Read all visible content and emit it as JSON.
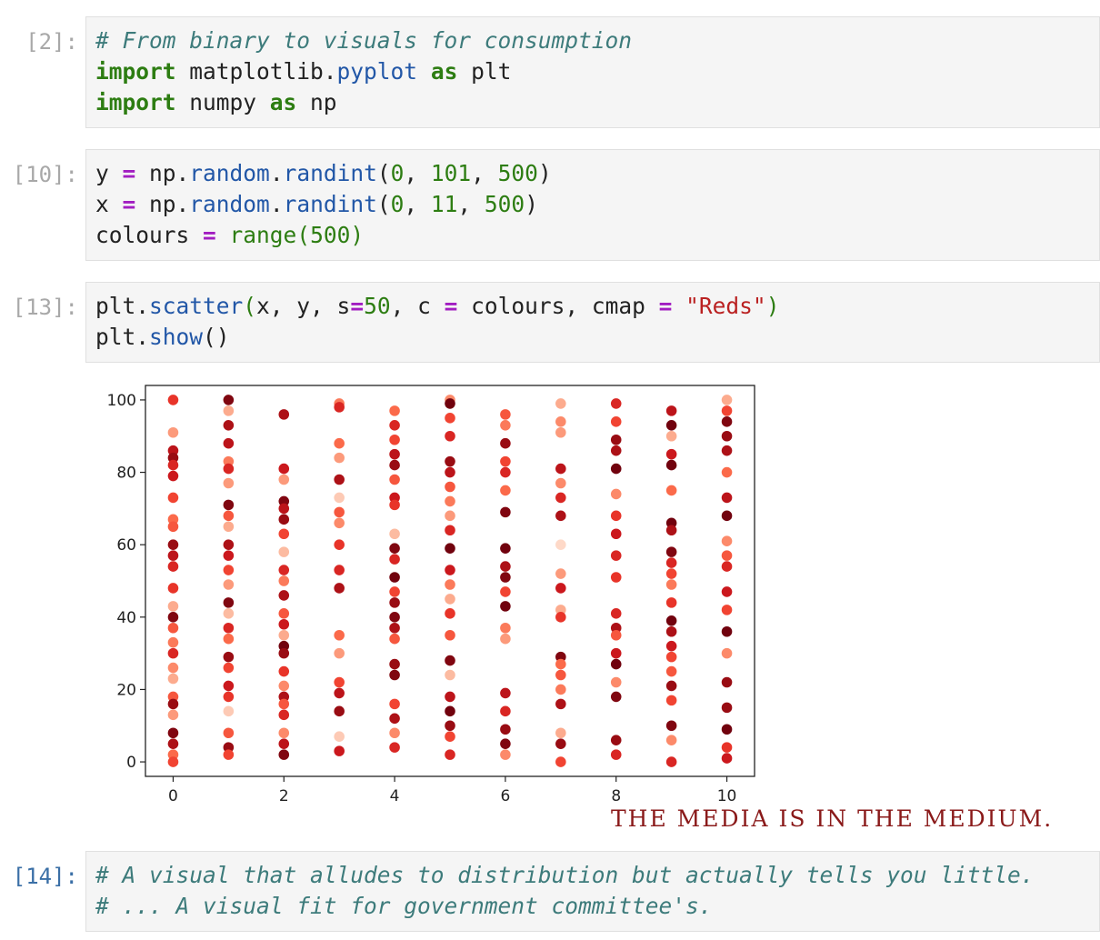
{
  "cells": {
    "c2": {
      "prompt": "[2]:",
      "line1": {
        "comment": "# From binary to visuals for consumption"
      },
      "line2": {
        "kw1": "import",
        "t1": " matplotlib.",
        "attr": "pyplot",
        "t2": " ",
        "kw2": "as",
        "t3": " plt"
      },
      "line3": {
        "kw1": "import",
        "t1": " numpy ",
        "kw2": "as",
        "t2": " np"
      }
    },
    "c10": {
      "prompt": "[10]:",
      "line1": {
        "v": "y ",
        "op": "=",
        "t1": " np.",
        "a1": "random",
        "t2": ".",
        "a2": "randint",
        "p1": "(",
        "n1": "0",
        "t3": ", ",
        "n2": "101",
        "t4": ", ",
        "n3": "500",
        "p2": ")"
      },
      "line2": {
        "v": "x ",
        "op": "=",
        "t1": " np.",
        "a1": "random",
        "t2": ".",
        "a2": "randint",
        "p1": "(",
        "n1": "0",
        "t3": ", ",
        "n2": "11",
        "t4": ", ",
        "n3": "500",
        "p2": ")"
      },
      "line3": {
        "v": "colours ",
        "op": "=",
        "t1": " ",
        "fn": "range",
        "p1": "(",
        "n1": "500",
        "p2": ")"
      }
    },
    "c13": {
      "prompt": "[13]:",
      "line1": {
        "t1": "plt.",
        "a1": "scatter",
        "p1": "(",
        "t2": "x, y, s",
        "op1": "=",
        "n1": "50",
        "t3": ", c ",
        "op2": "=",
        "t4": " colours, cmap ",
        "op3": "=",
        "t5": " ",
        "s1": "\"Reds\"",
        "p2": ")"
      },
      "line2": {
        "t1": "plt.",
        "a1": "show",
        "t2": "()"
      }
    },
    "c14": {
      "prompt": "[14]:",
      "line1": {
        "comment": "# A visual that alludes to distribution but actually tells you little."
      },
      "line2": {
        "comment": "# ... A visual fit for government committee's."
      }
    }
  },
  "caption": "THE MEDIA IS IN THE MEDIUM.",
  "chart_data": {
    "type": "scatter",
    "colormap": "Reds",
    "marker_size": 50,
    "xlim": [
      -0.5,
      10.5
    ],
    "ylim": [
      -4,
      104
    ],
    "xticks": [
      "0",
      "2",
      "4",
      "6",
      "8",
      "10"
    ],
    "yticks": [
      "0",
      "20",
      "40",
      "60",
      "80",
      "100"
    ],
    "points": [
      {
        "x": 0,
        "y": 100,
        "c": 0.65
      },
      {
        "x": 0,
        "y": 91,
        "c": 0.35
      },
      {
        "x": 0,
        "y": 86,
        "c": 0.8
      },
      {
        "x": 0,
        "y": 84,
        "c": 0.9
      },
      {
        "x": 0,
        "y": 82,
        "c": 0.7
      },
      {
        "x": 0,
        "y": 79,
        "c": 0.75
      },
      {
        "x": 0,
        "y": 73,
        "c": 0.6
      },
      {
        "x": 0,
        "y": 67,
        "c": 0.5
      },
      {
        "x": 0,
        "y": 65,
        "c": 0.55
      },
      {
        "x": 0,
        "y": 60,
        "c": 0.9
      },
      {
        "x": 0,
        "y": 57,
        "c": 0.8
      },
      {
        "x": 0,
        "y": 54,
        "c": 0.7
      },
      {
        "x": 0,
        "y": 48,
        "c": 0.65
      },
      {
        "x": 0,
        "y": 43,
        "c": 0.3
      },
      {
        "x": 0,
        "y": 40,
        "c": 0.95
      },
      {
        "x": 0,
        "y": 37,
        "c": 0.55
      },
      {
        "x": 0,
        "y": 33,
        "c": 0.45
      },
      {
        "x": 0,
        "y": 30,
        "c": 0.7
      },
      {
        "x": 0,
        "y": 26,
        "c": 0.4
      },
      {
        "x": 0,
        "y": 23,
        "c": 0.3
      },
      {
        "x": 0,
        "y": 18,
        "c": 0.55
      },
      {
        "x": 0,
        "y": 16,
        "c": 0.9
      },
      {
        "x": 0,
        "y": 13,
        "c": 0.35
      },
      {
        "x": 0,
        "y": 8,
        "c": 0.95
      },
      {
        "x": 0,
        "y": 5,
        "c": 0.85
      },
      {
        "x": 0,
        "y": 2,
        "c": 0.5
      },
      {
        "x": 0,
        "y": 0,
        "c": 0.6
      },
      {
        "x": 1,
        "y": 100,
        "c": 0.95
      },
      {
        "x": 1,
        "y": 97,
        "c": 0.3
      },
      {
        "x": 1,
        "y": 93,
        "c": 0.85
      },
      {
        "x": 1,
        "y": 88,
        "c": 0.8
      },
      {
        "x": 1,
        "y": 83,
        "c": 0.45
      },
      {
        "x": 1,
        "y": 81,
        "c": 0.7
      },
      {
        "x": 1,
        "y": 77,
        "c": 0.35
      },
      {
        "x": 1,
        "y": 71,
        "c": 0.95
      },
      {
        "x": 1,
        "y": 68,
        "c": 0.55
      },
      {
        "x": 1,
        "y": 65,
        "c": 0.3
      },
      {
        "x": 1,
        "y": 60,
        "c": 0.85
      },
      {
        "x": 1,
        "y": 57,
        "c": 0.75
      },
      {
        "x": 1,
        "y": 53,
        "c": 0.6
      },
      {
        "x": 1,
        "y": 49,
        "c": 0.35
      },
      {
        "x": 1,
        "y": 44,
        "c": 0.95
      },
      {
        "x": 1,
        "y": 41,
        "c": 0.25
      },
      {
        "x": 1,
        "y": 37,
        "c": 0.7
      },
      {
        "x": 1,
        "y": 34,
        "c": 0.5
      },
      {
        "x": 1,
        "y": 29,
        "c": 0.9
      },
      {
        "x": 1,
        "y": 26,
        "c": 0.6
      },
      {
        "x": 1,
        "y": 21,
        "c": 0.75
      },
      {
        "x": 1,
        "y": 18,
        "c": 0.65
      },
      {
        "x": 1,
        "y": 14,
        "c": 0.2
      },
      {
        "x": 1,
        "y": 8,
        "c": 0.55
      },
      {
        "x": 1,
        "y": 4,
        "c": 0.9
      },
      {
        "x": 1,
        "y": 2,
        "c": 0.6
      },
      {
        "x": 2,
        "y": 96,
        "c": 0.85
      },
      {
        "x": 2,
        "y": 81,
        "c": 0.75
      },
      {
        "x": 2,
        "y": 78,
        "c": 0.35
      },
      {
        "x": 2,
        "y": 72,
        "c": 0.95
      },
      {
        "x": 2,
        "y": 70,
        "c": 0.8
      },
      {
        "x": 2,
        "y": 67,
        "c": 0.9
      },
      {
        "x": 2,
        "y": 63,
        "c": 0.6
      },
      {
        "x": 2,
        "y": 58,
        "c": 0.25
      },
      {
        "x": 2,
        "y": 53,
        "c": 0.7
      },
      {
        "x": 2,
        "y": 50,
        "c": 0.45
      },
      {
        "x": 2,
        "y": 46,
        "c": 0.85
      },
      {
        "x": 2,
        "y": 41,
        "c": 0.55
      },
      {
        "x": 2,
        "y": 38,
        "c": 0.75
      },
      {
        "x": 2,
        "y": 35,
        "c": 0.3
      },
      {
        "x": 2,
        "y": 32,
        "c": 0.98
      },
      {
        "x": 2,
        "y": 30,
        "c": 0.9
      },
      {
        "x": 2,
        "y": 25,
        "c": 0.65
      },
      {
        "x": 2,
        "y": 21,
        "c": 0.4
      },
      {
        "x": 2,
        "y": 18,
        "c": 0.85
      },
      {
        "x": 2,
        "y": 16,
        "c": 0.55
      },
      {
        "x": 2,
        "y": 13,
        "c": 0.7
      },
      {
        "x": 2,
        "y": 8,
        "c": 0.4
      },
      {
        "x": 2,
        "y": 5,
        "c": 0.8
      },
      {
        "x": 2,
        "y": 2,
        "c": 0.95
      },
      {
        "x": 3,
        "y": 99,
        "c": 0.45
      },
      {
        "x": 3,
        "y": 98,
        "c": 0.7
      },
      {
        "x": 3,
        "y": 88,
        "c": 0.5
      },
      {
        "x": 3,
        "y": 84,
        "c": 0.35
      },
      {
        "x": 3,
        "y": 78,
        "c": 0.85
      },
      {
        "x": 3,
        "y": 73,
        "c": 0.2
      },
      {
        "x": 3,
        "y": 69,
        "c": 0.55
      },
      {
        "x": 3,
        "y": 66,
        "c": 0.4
      },
      {
        "x": 3,
        "y": 60,
        "c": 0.65
      },
      {
        "x": 3,
        "y": 53,
        "c": 0.7
      },
      {
        "x": 3,
        "y": 48,
        "c": 0.85
      },
      {
        "x": 3,
        "y": 35,
        "c": 0.5
      },
      {
        "x": 3,
        "y": 30,
        "c": 0.35
      },
      {
        "x": 3,
        "y": 22,
        "c": 0.6
      },
      {
        "x": 3,
        "y": 19,
        "c": 0.8
      },
      {
        "x": 3,
        "y": 14,
        "c": 0.9
      },
      {
        "x": 3,
        "y": 7,
        "c": 0.2
      },
      {
        "x": 3,
        "y": 3,
        "c": 0.75
      },
      {
        "x": 4,
        "y": 97,
        "c": 0.5
      },
      {
        "x": 4,
        "y": 93,
        "c": 0.7
      },
      {
        "x": 4,
        "y": 89,
        "c": 0.6
      },
      {
        "x": 4,
        "y": 85,
        "c": 0.8
      },
      {
        "x": 4,
        "y": 82,
        "c": 0.9
      },
      {
        "x": 4,
        "y": 78,
        "c": 0.55
      },
      {
        "x": 4,
        "y": 73,
        "c": 0.75
      },
      {
        "x": 4,
        "y": 71,
        "c": 0.65
      },
      {
        "x": 4,
        "y": 63,
        "c": 0.25
      },
      {
        "x": 4,
        "y": 59,
        "c": 0.95
      },
      {
        "x": 4,
        "y": 56,
        "c": 0.7
      },
      {
        "x": 4,
        "y": 51,
        "c": 0.98
      },
      {
        "x": 4,
        "y": 47,
        "c": 0.6
      },
      {
        "x": 4,
        "y": 44,
        "c": 0.9
      },
      {
        "x": 4,
        "y": 40,
        "c": 0.95
      },
      {
        "x": 4,
        "y": 37,
        "c": 0.85
      },
      {
        "x": 4,
        "y": 34,
        "c": 0.55
      },
      {
        "x": 4,
        "y": 27,
        "c": 0.9
      },
      {
        "x": 4,
        "y": 24,
        "c": 0.95
      },
      {
        "x": 4,
        "y": 16,
        "c": 0.6
      },
      {
        "x": 4,
        "y": 12,
        "c": 0.85
      },
      {
        "x": 4,
        "y": 8,
        "c": 0.4
      },
      {
        "x": 4,
        "y": 4,
        "c": 0.7
      },
      {
        "x": 5,
        "y": 100,
        "c": 0.4
      },
      {
        "x": 5,
        "y": 99,
        "c": 0.98
      },
      {
        "x": 5,
        "y": 95,
        "c": 0.6
      },
      {
        "x": 5,
        "y": 90,
        "c": 0.7
      },
      {
        "x": 5,
        "y": 83,
        "c": 0.9
      },
      {
        "x": 5,
        "y": 80,
        "c": 0.8
      },
      {
        "x": 5,
        "y": 76,
        "c": 0.55
      },
      {
        "x": 5,
        "y": 72,
        "c": 0.45
      },
      {
        "x": 5,
        "y": 68,
        "c": 0.35
      },
      {
        "x": 5,
        "y": 64,
        "c": 0.7
      },
      {
        "x": 5,
        "y": 59,
        "c": 0.98
      },
      {
        "x": 5,
        "y": 53,
        "c": 0.75
      },
      {
        "x": 5,
        "y": 49,
        "c": 0.45
      },
      {
        "x": 5,
        "y": 45,
        "c": 0.3
      },
      {
        "x": 5,
        "y": 41,
        "c": 0.65
      },
      {
        "x": 5,
        "y": 35,
        "c": 0.55
      },
      {
        "x": 5,
        "y": 28,
        "c": 0.95
      },
      {
        "x": 5,
        "y": 24,
        "c": 0.25
      },
      {
        "x": 5,
        "y": 18,
        "c": 0.8
      },
      {
        "x": 5,
        "y": 14,
        "c": 0.98
      },
      {
        "x": 5,
        "y": 10,
        "c": 0.9
      },
      {
        "x": 5,
        "y": 7,
        "c": 0.6
      },
      {
        "x": 5,
        "y": 2,
        "c": 0.7
      },
      {
        "x": 6,
        "y": 96,
        "c": 0.55
      },
      {
        "x": 6,
        "y": 93,
        "c": 0.45
      },
      {
        "x": 6,
        "y": 88,
        "c": 0.9
      },
      {
        "x": 6,
        "y": 83,
        "c": 0.6
      },
      {
        "x": 6,
        "y": 80,
        "c": 0.7
      },
      {
        "x": 6,
        "y": 75,
        "c": 0.5
      },
      {
        "x": 6,
        "y": 69,
        "c": 0.95
      },
      {
        "x": 6,
        "y": 59,
        "c": 0.98
      },
      {
        "x": 6,
        "y": 54,
        "c": 0.85
      },
      {
        "x": 6,
        "y": 51,
        "c": 0.95
      },
      {
        "x": 6,
        "y": 47,
        "c": 0.6
      },
      {
        "x": 6,
        "y": 43,
        "c": 0.98
      },
      {
        "x": 6,
        "y": 37,
        "c": 0.45
      },
      {
        "x": 6,
        "y": 34,
        "c": 0.35
      },
      {
        "x": 6,
        "y": 19,
        "c": 0.8
      },
      {
        "x": 6,
        "y": 14,
        "c": 0.7
      },
      {
        "x": 6,
        "y": 9,
        "c": 0.9
      },
      {
        "x": 6,
        "y": 5,
        "c": 0.95
      },
      {
        "x": 6,
        "y": 2,
        "c": 0.4
      },
      {
        "x": 7,
        "y": 99,
        "c": 0.3
      },
      {
        "x": 7,
        "y": 94,
        "c": 0.4
      },
      {
        "x": 7,
        "y": 91,
        "c": 0.35
      },
      {
        "x": 7,
        "y": 81,
        "c": 0.8
      },
      {
        "x": 7,
        "y": 77,
        "c": 0.4
      },
      {
        "x": 7,
        "y": 73,
        "c": 0.7
      },
      {
        "x": 7,
        "y": 68,
        "c": 0.85
      },
      {
        "x": 7,
        "y": 60,
        "c": 0.15
      },
      {
        "x": 7,
        "y": 52,
        "c": 0.35
      },
      {
        "x": 7,
        "y": 48,
        "c": 0.75
      },
      {
        "x": 7,
        "y": 42,
        "c": 0.3
      },
      {
        "x": 7,
        "y": 40,
        "c": 0.65
      },
      {
        "x": 7,
        "y": 29,
        "c": 0.95
      },
      {
        "x": 7,
        "y": 27,
        "c": 0.5
      },
      {
        "x": 7,
        "y": 24,
        "c": 0.55
      },
      {
        "x": 7,
        "y": 20,
        "c": 0.45
      },
      {
        "x": 7,
        "y": 16,
        "c": 0.85
      },
      {
        "x": 7,
        "y": 8,
        "c": 0.3
      },
      {
        "x": 7,
        "y": 5,
        "c": 0.9
      },
      {
        "x": 7,
        "y": 0,
        "c": 0.6
      },
      {
        "x": 8,
        "y": 99,
        "c": 0.7
      },
      {
        "x": 8,
        "y": 94,
        "c": 0.6
      },
      {
        "x": 8,
        "y": 89,
        "c": 0.9
      },
      {
        "x": 8,
        "y": 86,
        "c": 0.85
      },
      {
        "x": 8,
        "y": 81,
        "c": 0.98
      },
      {
        "x": 8,
        "y": 74,
        "c": 0.4
      },
      {
        "x": 8,
        "y": 68,
        "c": 0.65
      },
      {
        "x": 8,
        "y": 63,
        "c": 0.75
      },
      {
        "x": 8,
        "y": 57,
        "c": 0.7
      },
      {
        "x": 8,
        "y": 51,
        "c": 0.65
      },
      {
        "x": 8,
        "y": 41,
        "c": 0.7
      },
      {
        "x": 8,
        "y": 37,
        "c": 0.85
      },
      {
        "x": 8,
        "y": 35,
        "c": 0.55
      },
      {
        "x": 8,
        "y": 30,
        "c": 0.75
      },
      {
        "x": 8,
        "y": 27,
        "c": 0.98
      },
      {
        "x": 8,
        "y": 22,
        "c": 0.4
      },
      {
        "x": 8,
        "y": 18,
        "c": 0.95
      },
      {
        "x": 8,
        "y": 6,
        "c": 0.9
      },
      {
        "x": 8,
        "y": 2,
        "c": 0.7
      },
      {
        "x": 9,
        "y": 97,
        "c": 0.8
      },
      {
        "x": 9,
        "y": 93,
        "c": 0.98
      },
      {
        "x": 9,
        "y": 90,
        "c": 0.3
      },
      {
        "x": 9,
        "y": 85,
        "c": 0.75
      },
      {
        "x": 9,
        "y": 82,
        "c": 0.98
      },
      {
        "x": 9,
        "y": 75,
        "c": 0.5
      },
      {
        "x": 9,
        "y": 66,
        "c": 0.98
      },
      {
        "x": 9,
        "y": 64,
        "c": 0.85
      },
      {
        "x": 9,
        "y": 58,
        "c": 0.95
      },
      {
        "x": 9,
        "y": 55,
        "c": 0.7
      },
      {
        "x": 9,
        "y": 52,
        "c": 0.6
      },
      {
        "x": 9,
        "y": 49,
        "c": 0.45
      },
      {
        "x": 9,
        "y": 44,
        "c": 0.65
      },
      {
        "x": 9,
        "y": 39,
        "c": 0.98
      },
      {
        "x": 9,
        "y": 36,
        "c": 0.85
      },
      {
        "x": 9,
        "y": 32,
        "c": 0.75
      },
      {
        "x": 9,
        "y": 29,
        "c": 0.6
      },
      {
        "x": 9,
        "y": 25,
        "c": 0.55
      },
      {
        "x": 9,
        "y": 21,
        "c": 0.9
      },
      {
        "x": 9,
        "y": 17,
        "c": 0.6
      },
      {
        "x": 9,
        "y": 10,
        "c": 0.95
      },
      {
        "x": 9,
        "y": 6,
        "c": 0.4
      },
      {
        "x": 9,
        "y": 0,
        "c": 0.7
      },
      {
        "x": 10,
        "y": 100,
        "c": 0.3
      },
      {
        "x": 10,
        "y": 97,
        "c": 0.6
      },
      {
        "x": 10,
        "y": 94,
        "c": 0.95
      },
      {
        "x": 10,
        "y": 90,
        "c": 0.9
      },
      {
        "x": 10,
        "y": 86,
        "c": 0.85
      },
      {
        "x": 10,
        "y": 80,
        "c": 0.5
      },
      {
        "x": 10,
        "y": 73,
        "c": 0.8
      },
      {
        "x": 10,
        "y": 68,
        "c": 0.98
      },
      {
        "x": 10,
        "y": 61,
        "c": 0.4
      },
      {
        "x": 10,
        "y": 57,
        "c": 0.55
      },
      {
        "x": 10,
        "y": 54,
        "c": 0.7
      },
      {
        "x": 10,
        "y": 47,
        "c": 0.75
      },
      {
        "x": 10,
        "y": 42,
        "c": 0.6
      },
      {
        "x": 10,
        "y": 36,
        "c": 0.98
      },
      {
        "x": 10,
        "y": 30,
        "c": 0.4
      },
      {
        "x": 10,
        "y": 22,
        "c": 0.9
      },
      {
        "x": 10,
        "y": 15,
        "c": 0.9
      },
      {
        "x": 10,
        "y": 9,
        "c": 0.98
      },
      {
        "x": 10,
        "y": 4,
        "c": 0.65
      },
      {
        "x": 10,
        "y": 1,
        "c": 0.75
      }
    ]
  }
}
